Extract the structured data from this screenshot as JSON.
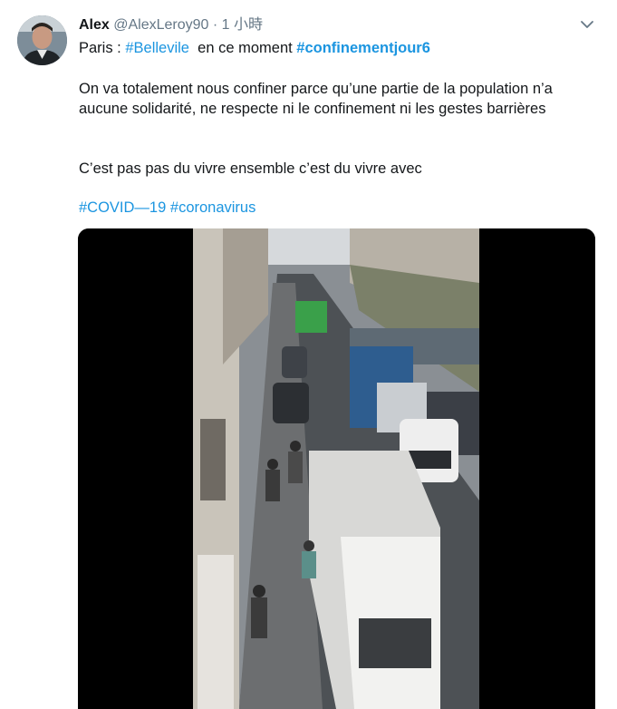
{
  "author": {
    "name": "Alex",
    "handle": "@AlexLeroy90",
    "separator": "·",
    "time": "1 小時"
  },
  "tweet": {
    "line1_prefix": "Paris : ",
    "line1_tag1": "#Bellevile",
    "line1_middle": "en ce moment ",
    "line1_tag2": "#confinementjour6",
    "paragraph1": "On va totalement nous confiner parce qu’une partie de la population n’a aucune solidarité, ne respecte ni le confinement ni les gestes barrières",
    "paragraph2": "C’est pas pas du vivre ensemble c’est du vivre avec",
    "tag_covid": "#COVID—19",
    "tag_corona": "#coronavirus"
  },
  "colors": {
    "link": "#1b95e0",
    "text": "#14171a",
    "meta": "#657786"
  },
  "icons": {
    "caret": "chevron-down-icon",
    "avatar": "profile-photo"
  },
  "media": {
    "kind": "video-frame",
    "description_shown": ""
  }
}
